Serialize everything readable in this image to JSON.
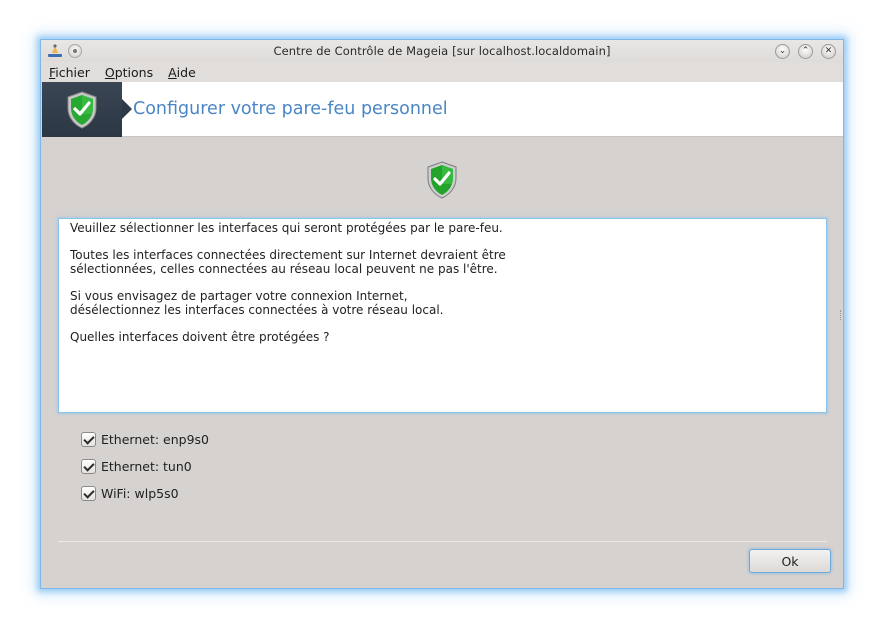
{
  "window": {
    "title": "Centre de Contrôle de Mageia  [sur localhost.localdomain]"
  },
  "menubar": {
    "items": [
      {
        "label": "Fichier",
        "mnemonic": "F",
        "rest": "ichier"
      },
      {
        "label": "Options",
        "mnemonic": "O",
        "rest": "ptions"
      },
      {
        "label": "Aide",
        "mnemonic": "A",
        "rest": "ide"
      }
    ]
  },
  "banner": {
    "title": "Configurer votre pare-feu personnel",
    "icon": "shield-check-icon"
  },
  "info": {
    "paragraphs": [
      "Veuillez sélectionner les interfaces qui seront protégées par le pare-feu.",
      "Toutes les interfaces connectées directement sur Internet devraient être\nsélectionnées, celles connectées au réseau local peuvent ne pas l'être.",
      "Si vous envisagez de partager votre connexion Internet,\ndésélectionnez les interfaces connectées à votre réseau local.",
      "Quelles interfaces doivent être protégées ?"
    ]
  },
  "interfaces": [
    {
      "label": "Ethernet: enp9s0",
      "checked": true
    },
    {
      "label": "Ethernet: tun0",
      "checked": true
    },
    {
      "label": "WiFi: wlp5s0",
      "checked": true
    }
  ],
  "buttons": {
    "ok_label": "Ok"
  },
  "colors": {
    "accent": "#4a86c6",
    "banner_dark": "#2c3744",
    "shield_green": "#22a32a",
    "focus_border": "#8cc3ea"
  }
}
